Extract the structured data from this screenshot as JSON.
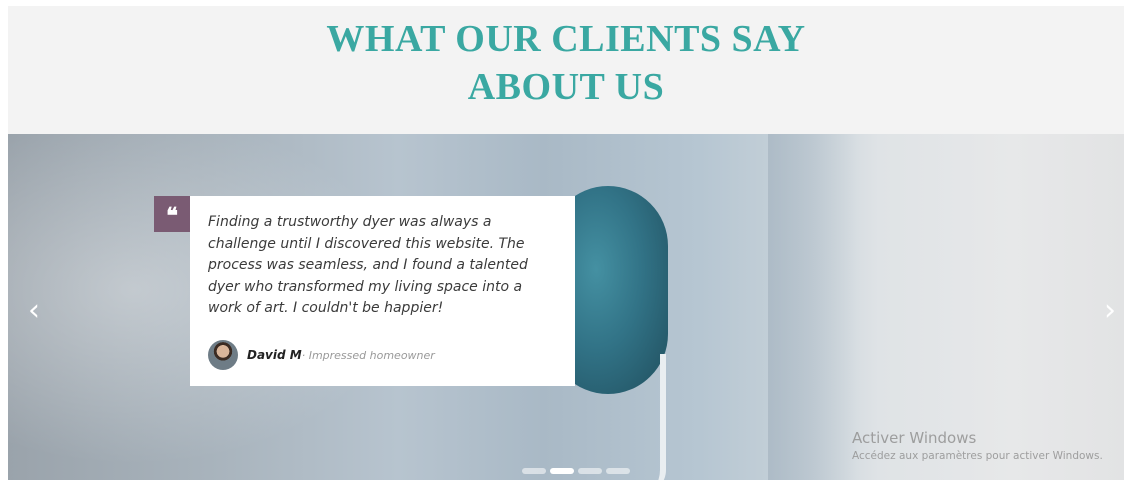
{
  "section": {
    "title_line1": "WHAT OUR CLIENTS SAY",
    "title_line2": "ABOUT US"
  },
  "carousel": {
    "prev_icon": "chevron-left-icon",
    "next_icon": "chevron-right-icon",
    "prev_glyph": "‹",
    "next_glyph": "›",
    "quote_icon_glyph": "❝",
    "active_slide": 2,
    "total_slides": 4
  },
  "testimonial": {
    "quote": "Finding a trustworthy dyer was always a challenge until I discovered this website. The process was seamless, and I found a talented dyer who transformed my living space into a work of art. I couldn't be happier!",
    "author_name": "David M",
    "author_role": "· Impressed homeowner"
  },
  "watermark": {
    "title": "Activer Windows",
    "subtitle": "Accédez aux paramètres pour activer Windows."
  },
  "colors": {
    "title": "#3aa8a2",
    "quote_badge": "#7a5b73"
  }
}
